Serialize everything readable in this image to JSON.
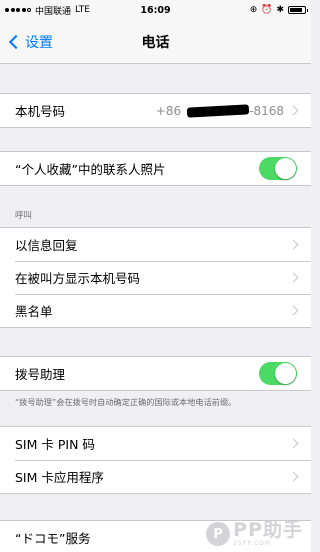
{
  "status_bar": {
    "carrier": "中国联通",
    "network": "LTE",
    "time": "16:09",
    "battery_level": 0.85
  },
  "nav": {
    "back_label": "设置",
    "title": "电话"
  },
  "my_number": {
    "label": "本机号码",
    "prefix": "+86",
    "suffix": "-8168"
  },
  "favorites_photos": {
    "label": "“个人收藏”中的联系人照片",
    "enabled": true
  },
  "calls_section": {
    "header": "呼叫"
  },
  "calls": [
    {
      "label": "以信息回复"
    },
    {
      "label": "在被叫方显示本机号码"
    },
    {
      "label": "黑名单"
    }
  ],
  "dial_assist": {
    "label": "拨号助理",
    "enabled": true,
    "note": "“拨号助理”会在拨号时自动确定正确的国际或本地电话前缀。"
  },
  "sim": [
    {
      "label": "SIM 卡 PIN 码"
    },
    {
      "label": "SIM 卡应用程序"
    }
  ],
  "docomo": {
    "label": "“ドコモ”服务"
  },
  "watermark": {
    "logo": "P",
    "main": "PP助手",
    "sub": "25PP.COM"
  },
  "colors": {
    "accent": "#007aff",
    "toggle_on": "#4cd964",
    "background": "#efeff4"
  }
}
